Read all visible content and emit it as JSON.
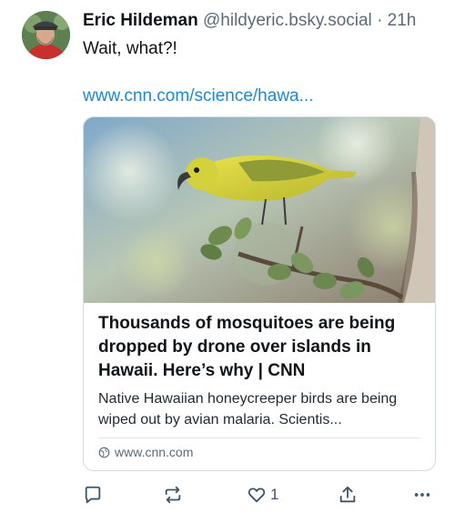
{
  "post": {
    "author_name": "Eric Hildeman",
    "author_handle": "@hildyeric.bsky.social",
    "separator": "·",
    "time": "21h",
    "text": "Wait, what?!",
    "link_text": "www.cnn.com/science/hawa..."
  },
  "card": {
    "title": "Thousands of mosquitoes are being dropped by drone over islands in Hawaii. Here’s why | CNN",
    "description": "Native Hawaiian honeycreeper birds are being wiped out by avian malaria. Scientis...",
    "domain": "www.cnn.com",
    "image_subject": "yellow honeycreeper bird on branch"
  },
  "actions": {
    "reply_icon": "reply-icon",
    "repost_icon": "repost-icon",
    "like_icon": "heart-icon",
    "like_count": "1",
    "share_icon": "share-icon",
    "more_icon": "more-icon"
  },
  "colors": {
    "link": "#1d88d6",
    "muted": "#5b6b7a",
    "border": "#d4dbe2",
    "action": "#3e5568"
  }
}
